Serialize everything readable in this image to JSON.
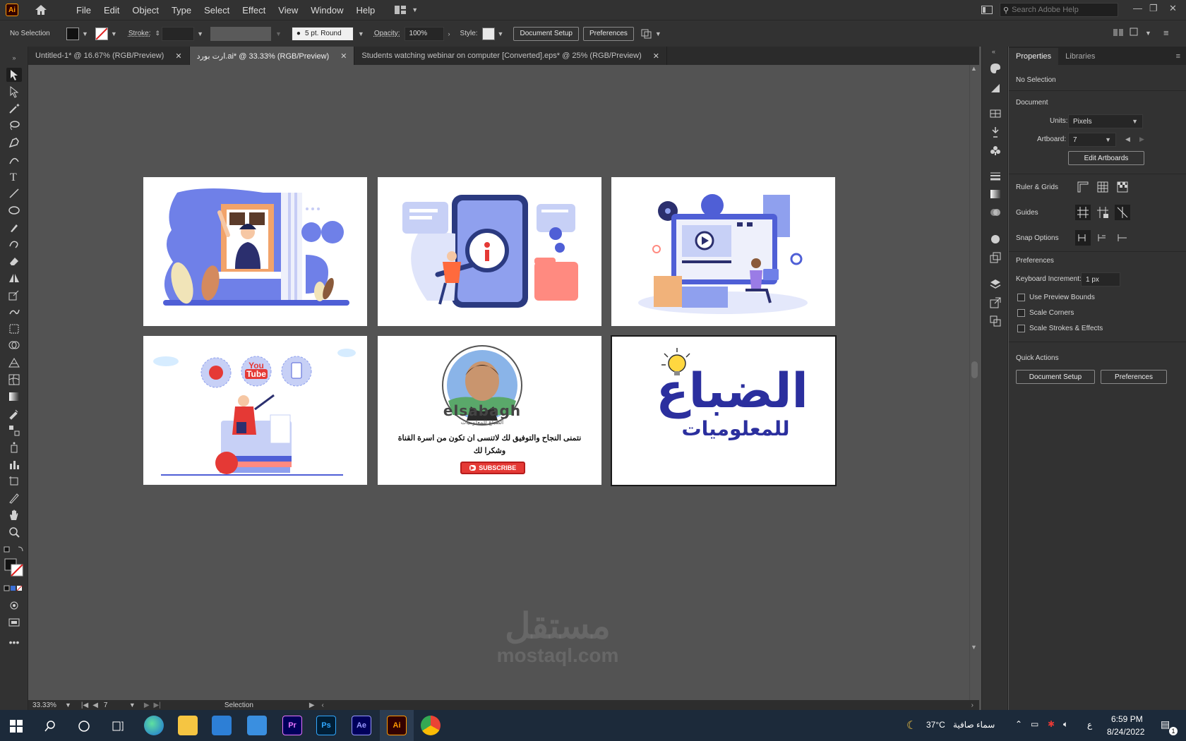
{
  "app": {
    "logo_label": "Ai",
    "menu": [
      "File",
      "Edit",
      "Object",
      "Type",
      "Select",
      "Effect",
      "View",
      "Window",
      "Help"
    ],
    "search_placeholder": "Search Adobe Help"
  },
  "control_bar": {
    "selection_label": "No Selection",
    "stroke_label": "Stroke:",
    "brush_value": "5 pt. Round",
    "opacity_label": "Opacity:",
    "opacity_value": "100%",
    "style_label": "Style:",
    "document_setup_label": "Document Setup",
    "preferences_label": "Preferences"
  },
  "tabs": [
    {
      "label": "Untitled-1* @ 16.67% (RGB/Preview)",
      "active": false
    },
    {
      "label": "ارت بورد.ai* @ 33.33% (RGB/Preview)",
      "active": true
    },
    {
      "label": "Students watching webinar on computer [Converted].eps* @ 25% (RGB/Preview)",
      "active": false
    }
  ],
  "artboards": {
    "ab5": {
      "brand": "elsabagh",
      "subbrand": "الضباع للمعلوميات",
      "message_line1": "نتمنى النجاح والتوفيق لك لاتنسى ان تكون من اسرة القناة",
      "message_line2": "وشكرا لك",
      "subscribe": "SUBSCRIBE"
    },
    "ab4": {
      "youtube_word1": "You",
      "youtube_word2": "Tube"
    },
    "ab6": {
      "logo_main": "الضباع",
      "logo_sub": "للمعلوميات"
    }
  },
  "status": {
    "zoom": "33.33%",
    "artboard_number": "7",
    "tool_name": "Selection"
  },
  "panel": {
    "tab_properties": "Properties",
    "tab_libraries": "Libraries",
    "no_selection": "No Selection",
    "document_heading": "Document",
    "units_label": "Units:",
    "units_value": "Pixels",
    "artboard_label": "Artboard:",
    "artboard_value": "7",
    "edit_artboards": "Edit Artboards",
    "ruler_grids": "Ruler & Grids",
    "guides": "Guides",
    "snap_options": "Snap Options",
    "preferences_heading": "Preferences",
    "keyboard_increment_label": "Keyboard Increment:",
    "keyboard_increment_value": "1 px",
    "use_preview_bounds": "Use Preview Bounds",
    "scale_corners": "Scale Corners",
    "scale_strokes": "Scale Strokes & Effects",
    "quick_actions": "Quick Actions",
    "qa_document_setup": "Document Setup",
    "qa_preferences": "Preferences"
  },
  "taskbar": {
    "apps": [
      "Pr",
      "Ps",
      "Ae",
      "Ai"
    ],
    "weather_temp": "37°C",
    "weather_text": "سماء صافية",
    "lang": "ع",
    "time": "6:59 PM",
    "date": "8/24/2022",
    "notif_count": "1"
  },
  "watermark": {
    "arabic": "مستقل",
    "latin": "mostaql.com"
  },
  "colors": {
    "accent_blue": "#4f5fd6",
    "light_blue": "#a9b6f2",
    "dark_navy": "#2b2f6e",
    "red": "#e53935",
    "ai_orange": "#ff9a00"
  }
}
